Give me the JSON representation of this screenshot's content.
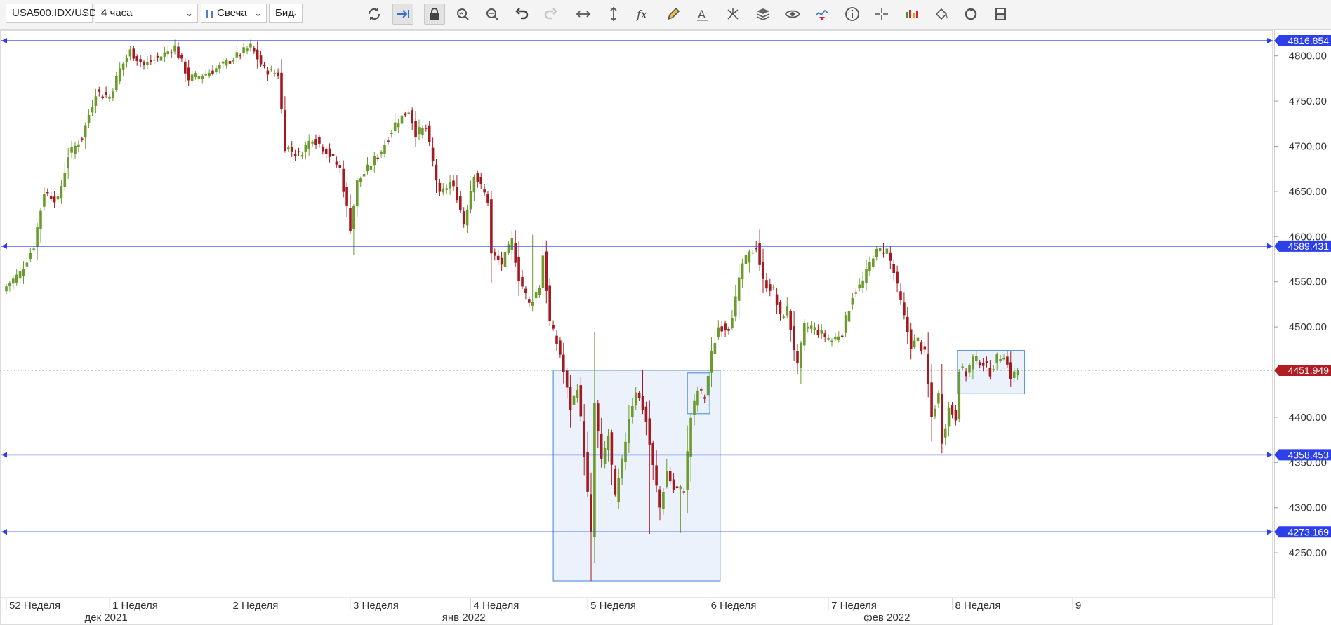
{
  "toolbar": {
    "symbol": "USA500.IDX/USD",
    "timeframe": "4 часа",
    "chart_type": "Свеча",
    "price_side": "Бид",
    "icons": [
      "refresh-icon",
      "shift-arrow-icon",
      "lock-icon",
      "zoom-in-icon",
      "zoom-out-icon",
      "undo-icon",
      "redo-icon",
      "horizontal-resize-icon",
      "vertical-resize-icon",
      "function-icon",
      "pencil-icon",
      "text-tool-icon",
      "pattern-icon",
      "layers-icon",
      "eye-icon",
      "indicator-chart-icon",
      "info-icon",
      "crosshair-icon",
      "bar-colors-icon",
      "paint-bucket-icon",
      "reset-icon",
      "save-icon"
    ]
  },
  "colors": {
    "up": "#6b9b2c",
    "down": "#a51a20",
    "hline": "#2d3fe8",
    "box_fill": "#e8f0fb",
    "box_stroke": "#5b97db",
    "last_price": "#b01d24"
  },
  "chart_data": {
    "type": "candlestick",
    "symbol": "USA500.IDX/USD",
    "ylim": [
      4220,
      4825
    ],
    "y_ticks": [
      4250,
      4300,
      4350,
      4400,
      4450,
      4500,
      4550,
      4600,
      4650,
      4700,
      4750,
      4800
    ],
    "y_tick_labels": [
      "4250.00",
      "4300.00",
      "4350.00",
      "4400.00",
      "4450.00",
      "4500.00",
      "4550.00",
      "4600.00",
      "4650.00",
      "4700.00",
      "4750.00",
      "4800.00"
    ],
    "x_labels": [
      {
        "label": "52 Неделя",
        "bar": 0
      },
      {
        "label": "1 Неделя",
        "bar": 30
      },
      {
        "label": "2 Неделя",
        "bar": 65
      },
      {
        "label": "3 Неделя",
        "bar": 100
      },
      {
        "label": "4 Неделя",
        "bar": 135
      },
      {
        "label": "5 Неделя",
        "bar": 169
      },
      {
        "label": "6 Неделя",
        "bar": 204
      },
      {
        "label": "7 Неделя",
        "bar": 239
      },
      {
        "label": "8 Неделя",
        "bar": 275
      },
      {
        "label": "9",
        "bar": 310
      }
    ],
    "month_labels": [
      {
        "label": "дек 2021",
        "bar": 29
      },
      {
        "label": "янв 2022",
        "bar": 133
      },
      {
        "label": "фев 2022",
        "bar": 256
      }
    ],
    "horizontal_lines": [
      4816.854,
      4589.431,
      4358.453,
      4273.169
    ],
    "horizontal_line_labels": [
      "4816.854",
      "4589.431",
      "4358.453",
      "4273.169"
    ],
    "last_price": 4451.949,
    "last_price_label": "4451.949",
    "rectangles": [
      {
        "bar_from": 159,
        "bar_to": 207.5,
        "price_top": 4452,
        "price_bottom": 4219
      },
      {
        "bar_from": 198,
        "bar_to": 204.5,
        "price_top": 4449,
        "price_bottom": 4404
      },
      {
        "bar_from": 276.5,
        "bar_to": 296,
        "price_top": 4474,
        "price_bottom": 4426
      }
    ],
    "anchors": [
      [
        0,
        4545
      ],
      [
        4,
        4560
      ],
      [
        8,
        4590
      ],
      [
        11,
        4650
      ],
      [
        15,
        4640
      ],
      [
        18,
        4690
      ],
      [
        22,
        4710
      ],
      [
        26,
        4760
      ],
      [
        30,
        4755
      ],
      [
        33,
        4785
      ],
      [
        36,
        4805
      ],
      [
        40,
        4790
      ],
      [
        45,
        4800
      ],
      [
        49,
        4810
      ],
      [
        53,
        4775
      ],
      [
        58,
        4780
      ],
      [
        63,
        4790
      ],
      [
        67,
        4800
      ],
      [
        71,
        4810
      ],
      [
        75,
        4785
      ],
      [
        79,
        4780
      ],
      [
        81,
        4700
      ],
      [
        85,
        4690
      ],
      [
        89,
        4710
      ],
      [
        93,
        4695
      ],
      [
        97,
        4675
      ],
      [
        100,
        4610
      ],
      [
        102,
        4660
      ],
      [
        106,
        4680
      ],
      [
        109,
        4695
      ],
      [
        113,
        4725
      ],
      [
        117,
        4740
      ],
      [
        119,
        4715
      ],
      [
        122,
        4720
      ],
      [
        123,
        4700
      ],
      [
        126,
        4645
      ],
      [
        129,
        4660
      ],
      [
        131,
        4645
      ],
      [
        133,
        4615
      ],
      [
        136,
        4670
      ],
      [
        138,
        4655
      ],
      [
        140,
        4640
      ],
      [
        141,
        4580
      ],
      [
        144,
        4570
      ],
      [
        147,
        4595
      ],
      [
        149,
        4555
      ],
      [
        150,
        4545
      ],
      [
        152,
        4525
      ],
      [
        155,
        4545
      ],
      [
        156,
        4580
      ],
      [
        158,
        4505
      ],
      [
        161,
        4470
      ],
      [
        164,
        4410
      ],
      [
        166,
        4435
      ],
      [
        168,
        4360
      ],
      [
        170,
        4270
      ],
      [
        171,
        4415
      ],
      [
        173,
        4350
      ],
      [
        175,
        4380
      ],
      [
        177,
        4310
      ],
      [
        179,
        4350
      ],
      [
        181,
        4400
      ],
      [
        183,
        4430
      ],
      [
        185,
        4410
      ],
      [
        186,
        4395
      ],
      [
        188,
        4345
      ],
      [
        190,
        4300
      ],
      [
        192,
        4340
      ],
      [
        194,
        4320
      ],
      [
        197,
        4320
      ],
      [
        199,
        4400
      ],
      [
        201,
        4430
      ],
      [
        203,
        4422
      ],
      [
        205,
        4470
      ],
      [
        207,
        4500
      ],
      [
        210,
        4500
      ],
      [
        212,
        4530
      ],
      [
        214,
        4570
      ],
      [
        216,
        4580
      ],
      [
        218,
        4590
      ],
      [
        220,
        4550
      ],
      [
        223,
        4540
      ],
      [
        225,
        4510
      ],
      [
        227,
        4520
      ],
      [
        230,
        4455
      ],
      [
        232,
        4500
      ],
      [
        234,
        4500
      ],
      [
        236,
        4495
      ],
      [
        238,
        4490
      ],
      [
        240,
        4485
      ],
      [
        243,
        4495
      ],
      [
        246,
        4535
      ],
      [
        249,
        4550
      ],
      [
        252,
        4580
      ],
      [
        254,
        4585
      ],
      [
        256,
        4585
      ],
      [
        258,
        4560
      ],
      [
        261,
        4510
      ],
      [
        263,
        4480
      ],
      [
        265,
        4485
      ],
      [
        267,
        4470
      ],
      [
        269,
        4400
      ],
      [
        271,
        4425
      ],
      [
        272,
        4375
      ],
      [
        274,
        4410
      ],
      [
        276,
        4400
      ],
      [
        277,
        4455
      ],
      [
        279,
        4448
      ],
      [
        281,
        4465
      ],
      [
        284,
        4460
      ],
      [
        286,
        4450
      ],
      [
        288,
        4465
      ],
      [
        290,
        4470
      ],
      [
        292,
        4445
      ],
      [
        294,
        4452
      ]
    ]
  }
}
